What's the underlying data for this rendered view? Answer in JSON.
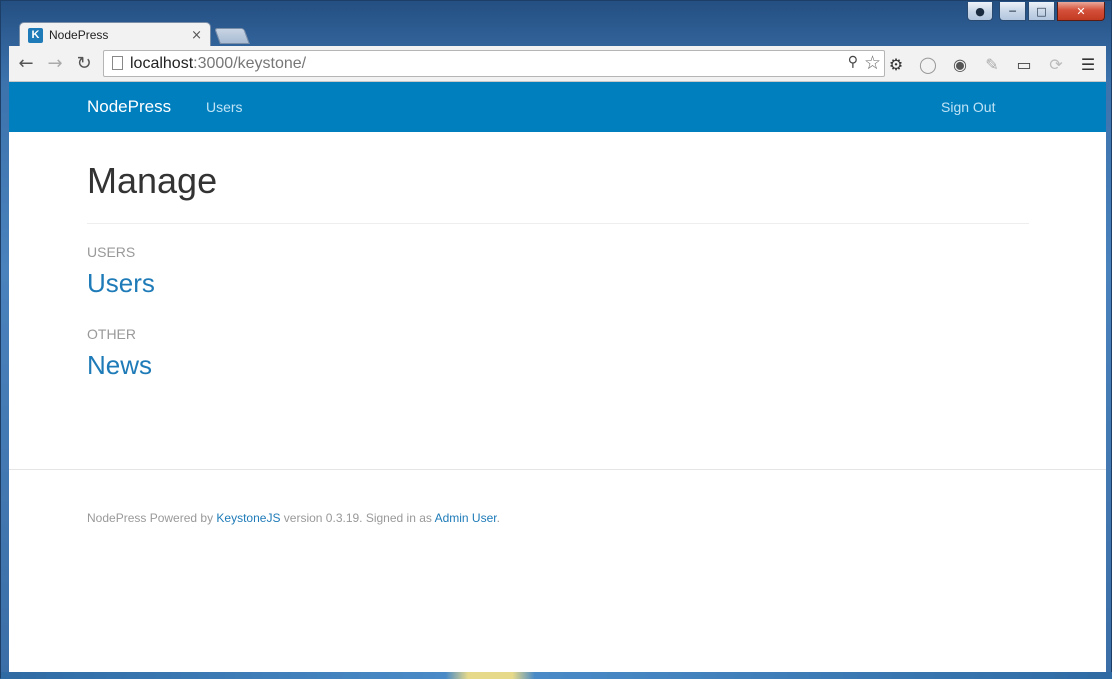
{
  "window": {
    "tab_title": "NodePress",
    "favicon_letter": "K",
    "tab_close": "×"
  },
  "caption_buttons": {
    "user": "user-icon",
    "minimize": "minimize-icon",
    "maximize": "maximize-icon",
    "close": "close-icon"
  },
  "toolbar": {
    "url_host": "localhost",
    "url_rest": ":3000/keystone/",
    "icons": [
      "back-icon",
      "forward-icon",
      "reload-icon",
      "page-icon",
      "key-icon",
      "star-icon",
      "gear-icon",
      "shield-icon",
      "extension-icon",
      "notes-icon",
      "cast-icon",
      "sync-icon",
      "menu-icon"
    ]
  },
  "navbar": {
    "brand": "NodePress",
    "users_link": "Users",
    "sign_out": "Sign Out"
  },
  "main": {
    "title": "Manage",
    "sections": [
      {
        "label": "USERS",
        "link": "Users"
      },
      {
        "label": "OTHER",
        "link": "News"
      }
    ]
  },
  "footer": {
    "prefix": "NodePress Powered by ",
    "keystone_link": "KeystoneJS",
    "middle": " version 0.3.19. Signed in as ",
    "user_link": "Admin User",
    "suffix": "."
  },
  "colors": {
    "navbar_bg": "#007fbf",
    "link": "#1e7bb8",
    "muted": "#999999"
  }
}
